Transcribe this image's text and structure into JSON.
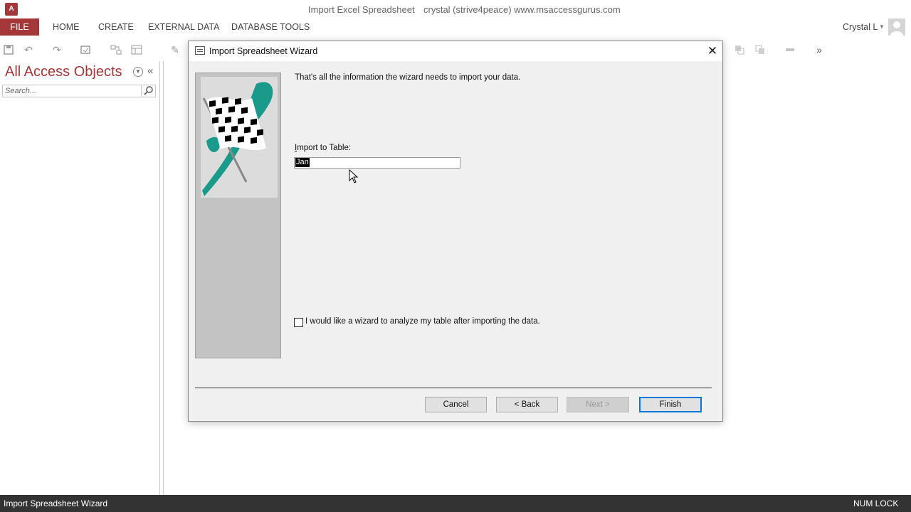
{
  "window": {
    "document_title": "Import Excel Spreadsheet",
    "site_title": "crystal (strive4peace) www.msaccessgurus.com",
    "app_icon_label": "A"
  },
  "ribbon": {
    "tabs": [
      {
        "label": "FILE"
      },
      {
        "label": "HOME"
      },
      {
        "label": "CREATE"
      },
      {
        "label": "EXTERNAL DATA"
      },
      {
        "label": "DATABASE TOOLS"
      }
    ],
    "user_name": "Crystal L",
    "accent_color": "#a4373a"
  },
  "nav_pane": {
    "title": "All Access Objects",
    "search_placeholder": "Search...",
    "collapse_icon": "double-chevron-left-icon"
  },
  "dialog": {
    "title": "Import Spreadsheet Wizard",
    "message": "That's all the information the wizard needs to import your data.",
    "import_label": "Import to Table:",
    "import_value": "Jan",
    "analyze_checkbox": {
      "label": "I would like a wizard to analyze my table after importing the data.",
      "checked": false
    },
    "buttons": {
      "cancel": "Cancel",
      "back": "< Back",
      "next": "Next >",
      "finish": "Finish"
    },
    "next_enabled": false
  },
  "status_bar": {
    "left": "Import Spreadsheet Wizard",
    "right": "NUM LOCK",
    "background": "#333333"
  }
}
